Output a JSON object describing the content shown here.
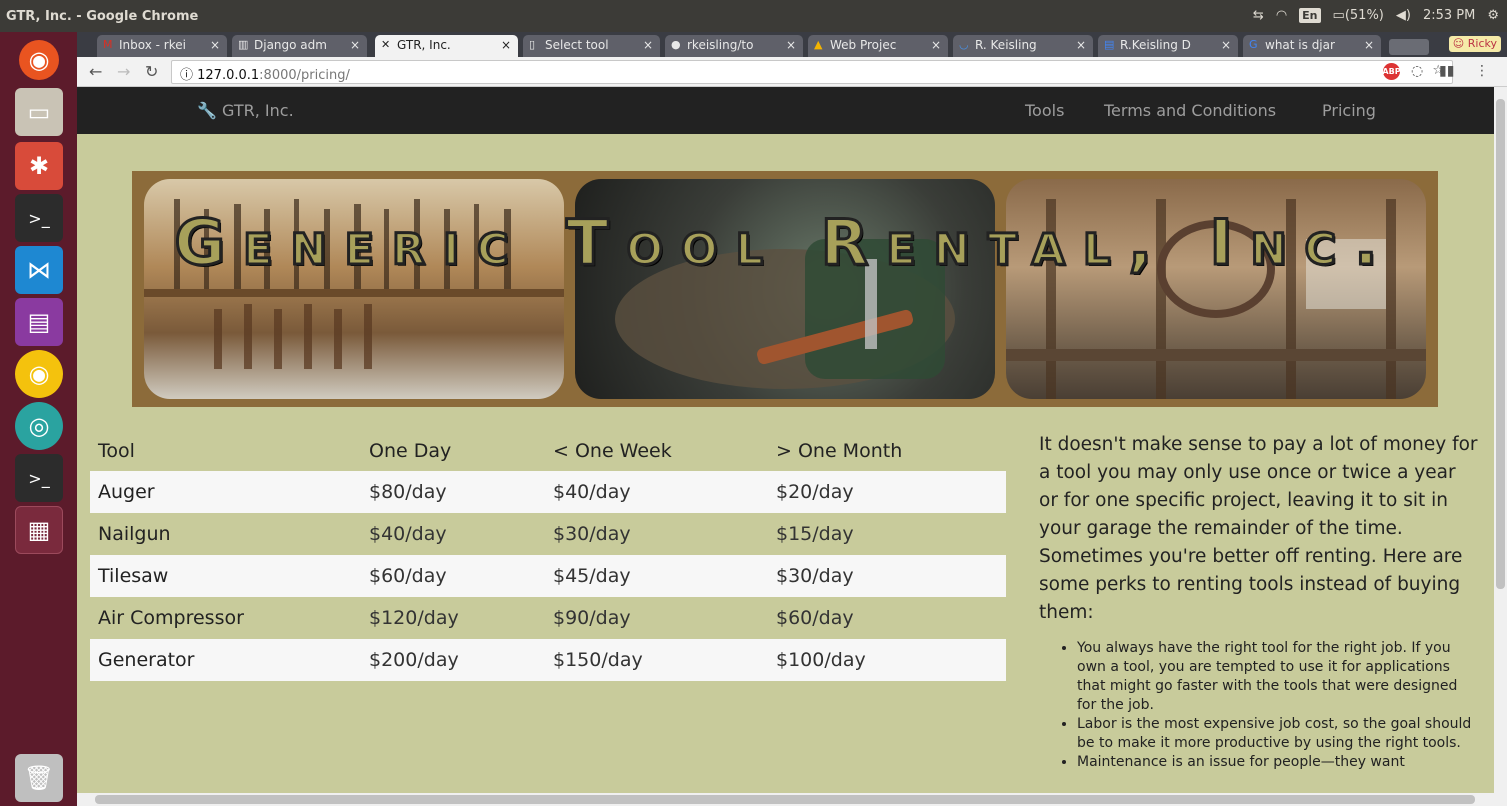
{
  "os": {
    "window_title": "GTR, Inc. - Google Chrome",
    "keyboard": "En",
    "battery": "(51%)",
    "time": "2:53 PM",
    "user": "Ricky"
  },
  "tabs": [
    {
      "label": "Inbox - rkei",
      "icon": "gmail-icon"
    },
    {
      "label": "Django adm",
      "icon": "book-icon"
    },
    {
      "label": "GTR, Inc.",
      "icon": "tools-icon",
      "active": true
    },
    {
      "label": "Select tool",
      "icon": "page-icon"
    },
    {
      "label": "rkeisling/to",
      "icon": "github-icon"
    },
    {
      "label": "Web Projec",
      "icon": "drive-icon"
    },
    {
      "label": "R. Keisling",
      "icon": "loading-icon"
    },
    {
      "label": "R.Keisling D",
      "icon": "docs-icon"
    },
    {
      "label": "what is djar",
      "icon": "google-icon"
    }
  ],
  "address": {
    "host": "127.0.0.1",
    "path": ":8000/pricing/"
  },
  "site": {
    "brand": "GTR, Inc.",
    "nav": [
      "Tools",
      "Terms and Conditions",
      "Pricing"
    ],
    "banner_title": "Generic Tool Rental, Inc."
  },
  "pricing": {
    "headers": [
      "Tool",
      "One Day",
      "< One Week",
      "> One Month"
    ],
    "rows": [
      [
        "Auger",
        "$80/day",
        "$40/day",
        "$20/day"
      ],
      [
        "Nailgun",
        "$40/day",
        "$30/day",
        "$15/day"
      ],
      [
        "Tilesaw",
        "$60/day",
        "$45/day",
        "$30/day"
      ],
      [
        "Air Compressor",
        "$120/day",
        "$90/day",
        "$60/day"
      ],
      [
        "Generator",
        "$200/day",
        "$150/day",
        "$100/day"
      ]
    ]
  },
  "side": {
    "intro": "It doesn't make sense to pay a lot of money for a tool you may only use once or twice a year or for one specific project, leaving it to sit in your garage the remainder of the time. Sometimes you're better off renting. Here are some perks to renting tools instead of buying them:",
    "perks": [
      "You always have the right tool for the right job. If you own a tool, you are tempted to use it for applications that might go faster with the tools that were designed for the job.",
      "Labor is the most expensive job cost, so the goal should be to make it more productive by using the right tools.",
      "Maintenance is an issue for people—they want"
    ]
  },
  "colors": {
    "page_bg": "#c8cb9b",
    "navbar_bg": "#222222",
    "banner_frame": "#8c6b3a",
    "launcher_bg": "#5c1b2b"
  }
}
